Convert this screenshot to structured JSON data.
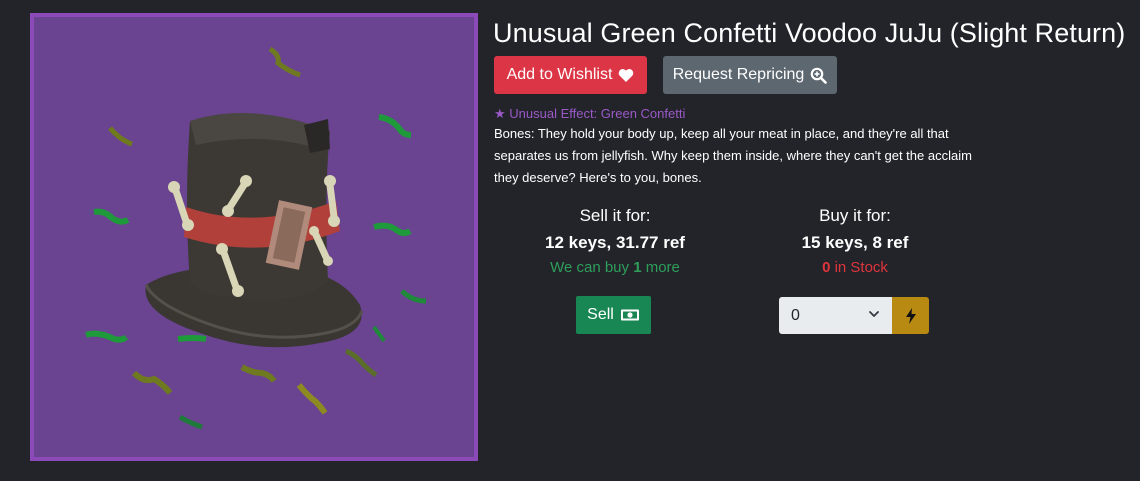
{
  "item": {
    "title": "Unusual Green Confetti Voodoo JuJu (Slight Return)",
    "image_alt": "Voodoo JuJu hat with green confetti effect",
    "frame_color": "#8b4ab8",
    "background_color": "#6a4391"
  },
  "actions": {
    "wishlist_label": "Add to Wishlist",
    "wishlist_icon": "heart-icon",
    "reprice_label": "Request Repricing",
    "reprice_icon": "magnifier-plus-icon"
  },
  "effect": {
    "text": "★ Unusual Effect: Green Confetti",
    "color": "#9b59c7"
  },
  "description": "Bones: They hold your body up, keep all your meat in place, and they're all that separates us from jellyfish. Why keep them inside, where they can't get the acclaim they deserve? Here's to you, bones.",
  "sell": {
    "heading": "Sell it for:",
    "price": "12 keys, 31.77 ref",
    "status_prefix": "We can buy ",
    "status_count": "1",
    "status_suffix": " more",
    "button_label": "Sell",
    "button_icon": "cash-icon",
    "color": "#198754"
  },
  "buy": {
    "heading": "Buy it for:",
    "price": "15 keys, 8 ref",
    "stock_count": "0",
    "stock_suffix": " in Stock",
    "quantity_selected": "0",
    "button_icon": "lightning-icon",
    "color": "#b88a12"
  }
}
